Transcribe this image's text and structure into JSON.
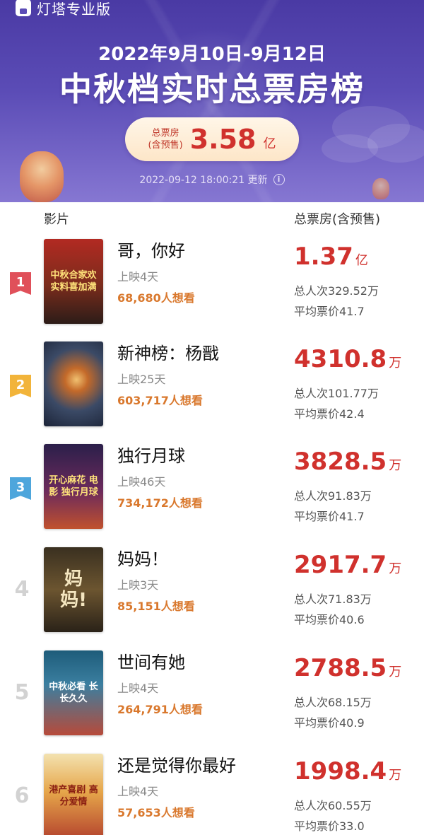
{
  "app": {
    "logo_text": "灯塔专业版"
  },
  "header": {
    "date_range": "2022年9月10日-9月12日",
    "title": "中秋档实时总票房榜",
    "total_label_line1": "总票房",
    "total_label_line2": "(含预售)",
    "total_value": "3.58",
    "total_unit": "亿",
    "updated": "2022-09-12 18:00:21 更新",
    "info_glyph": "i"
  },
  "table": {
    "col_film": "影片",
    "col_box": "总票房(含预售)"
  },
  "rank_colors": {
    "1": "#e0505a",
    "2": "#f2b43a",
    "3": "#4ea6dc"
  },
  "movies": [
    {
      "rank": "1",
      "title": "哥，你好",
      "days": "上映4天",
      "wish": "68,680人想看",
      "box": "1.37",
      "box_unit": "亿",
      "admissions": "总人次329.52万",
      "avg_price": "平均票价41.7",
      "poster_text": "中秋合家欢 实料喜加满"
    },
    {
      "rank": "2",
      "title": "新神榜：杨戬",
      "days": "上映25天",
      "wish": "603,717人想看",
      "box": "4310.8",
      "box_unit": "万",
      "admissions": "总人次101.77万",
      "avg_price": "平均票价42.4",
      "poster_text": ""
    },
    {
      "rank": "3",
      "title": "独行月球",
      "days": "上映46天",
      "wish": "734,172人想看",
      "box": "3828.5",
      "box_unit": "万",
      "admissions": "总人次91.83万",
      "avg_price": "平均票价41.7",
      "poster_text": "开心麻花 电影 独行月球"
    },
    {
      "rank": "4",
      "title": "妈妈！",
      "days": "上映3天",
      "wish": "85,151人想看",
      "box": "2917.7",
      "box_unit": "万",
      "admissions": "总人次71.83万",
      "avg_price": "平均票价40.6",
      "poster_text": "妈 妈!"
    },
    {
      "rank": "5",
      "title": "世间有她",
      "days": "上映4天",
      "wish": "264,791人想看",
      "box": "2788.5",
      "box_unit": "万",
      "admissions": "总人次68.15万",
      "avg_price": "平均票价40.9",
      "poster_text": "中秋必看 长长久久"
    },
    {
      "rank": "6",
      "title": "还是觉得你最好",
      "days": "上映4天",
      "wish": "57,653人想看",
      "box": "1998.4",
      "box_unit": "万",
      "admissions": "总人次60.55万",
      "avg_price": "平均票价33.0",
      "poster_text": "港产喜剧 高分爱情"
    }
  ]
}
